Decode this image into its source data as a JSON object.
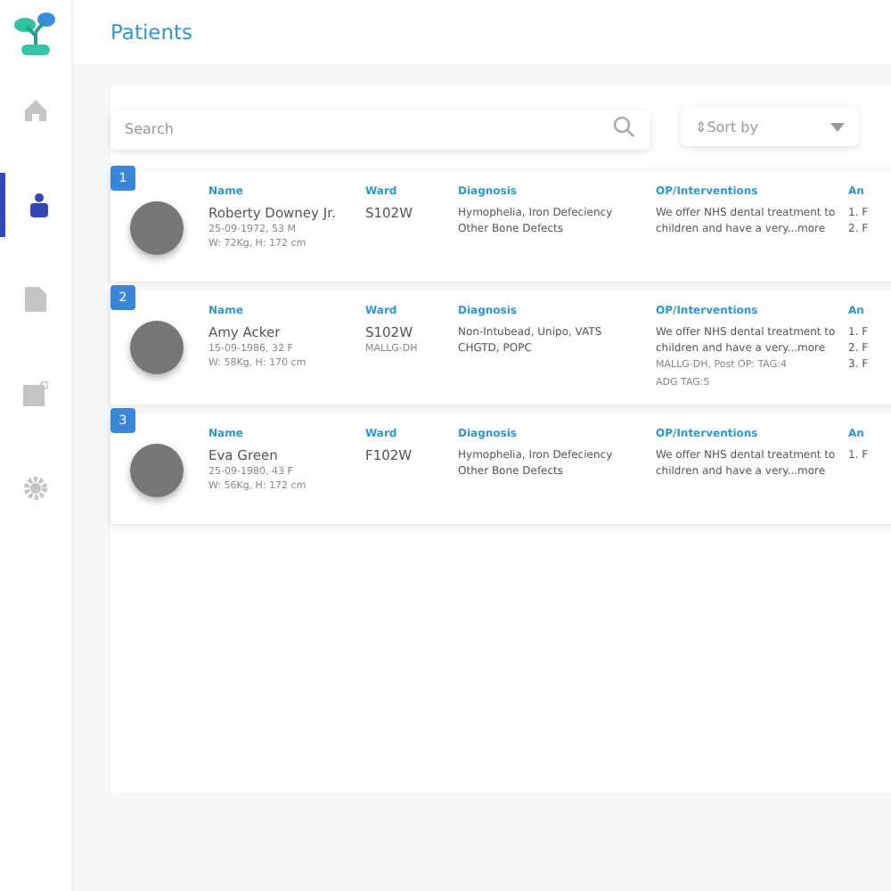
{
  "page_title": "Patients",
  "sidebar": {
    "items": [
      {
        "kind": "home",
        "selected": false
      },
      {
        "kind": "patient",
        "selected": true
      },
      {
        "kind": "document",
        "selected": false
      },
      {
        "kind": "note",
        "selected": false
      },
      {
        "kind": "settings",
        "selected": false
      }
    ]
  },
  "search": {
    "placeholder": "Search"
  },
  "sort": {
    "placeholder": "Sort by",
    "arrows": "⇕"
  },
  "patients": [
    {
      "index": "1",
      "labels": {
        "name": "Name",
        "ward": "Ward",
        "diagnosis": "Diagnosis",
        "op": "OP/Interventions",
        "column_5": "An"
      },
      "name": "Roberty Downey Jr.",
      "dob": "25-09-1972, 53 M",
      "measurements": "W: 72Kg, H: 172 cm",
      "ward": "S102W",
      "diagnosis": [
        "Hymophelia, Iron Defeciency",
        "Other Bone Defects"
      ],
      "op": "We offer NHS dental treatment to children and have a very...",
      "more": "more",
      "column_5": [
        "1. F",
        "2. F"
      ]
    },
    {
      "index": "2",
      "labels": {
        "name": "Name",
        "ward": "Ward",
        "diagnosis": "Diagnosis",
        "op": "OP/Interventions",
        "column_5": "An"
      },
      "name": "Amy Acker",
      "dob": "15-09-1986, 32 F",
      "measurements": "W: 58Kg, H: 170 cm",
      "ward": "S102W",
      "ward_note": "MALLG-DH",
      "diagnosis": [
        "Non-Intubead, Unipo, VATS",
        "CHGTD, POPC"
      ],
      "op": "We offer NHS dental treatment to children and have a very...",
      "more": "more",
      "op_note": [
        "MALLG-DH, Post OP: TAG:4",
        "ADG TAG:5"
      ],
      "column_5": [
        "1. F",
        "2. F",
        "3. F"
      ]
    },
    {
      "index": "3",
      "labels": {
        "name": "Name",
        "ward": "Ward",
        "diagnosis": "Diagnosis",
        "op": "OP/Interventions",
        "column_5": "An"
      },
      "name": "Eva Green",
      "dob": "25-09-1980, 43 F",
      "measurements": "W: 56Kg, H: 172 cm",
      "ward": "F102W",
      "diagnosis": [
        "Hymophelia, Iron Defeciency",
        "Other Bone Defects"
      ],
      "op": "We offer NHS dental treatment to children and have a very...",
      "more": "more",
      "column_5": [
        "1. F"
      ]
    }
  ]
}
